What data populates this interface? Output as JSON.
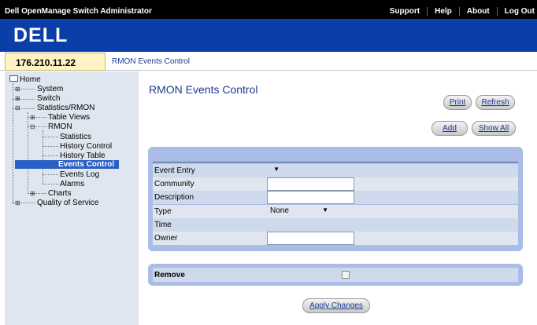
{
  "header": {
    "app_title": "Dell OpenManage Switch Administrator",
    "links": [
      "Support",
      "Help",
      "About",
      "Log Out"
    ],
    "logo": "DELL"
  },
  "ip_address": "176.210.11.22",
  "breadcrumb": "RMON Events Control",
  "sidebar": {
    "home": "Home",
    "system": "System",
    "switch": "Switch",
    "statistics_rmon": "Statistics/RMON",
    "table_views": "Table Views",
    "rmon": "RMON",
    "statistics": "Statistics",
    "history_control": "History Control",
    "history_table": "History Table",
    "events_control": "Events Control",
    "events_log": "Events Log",
    "alarms": "Alarms",
    "charts": "Charts",
    "quality_of_service": "Quality of Service"
  },
  "main": {
    "title": "RMON Events Control",
    "print_label": "Print",
    "refresh_label": "Refresh",
    "add_label": "Add",
    "show_all_label": "Show All",
    "fields": {
      "event_entry": "Event Entry",
      "community": "Community",
      "description": "Description",
      "type": "Type",
      "type_value": "None",
      "time": "Time",
      "owner": "Owner"
    },
    "remove_label": "Remove",
    "apply_label": "Apply Changes"
  }
}
